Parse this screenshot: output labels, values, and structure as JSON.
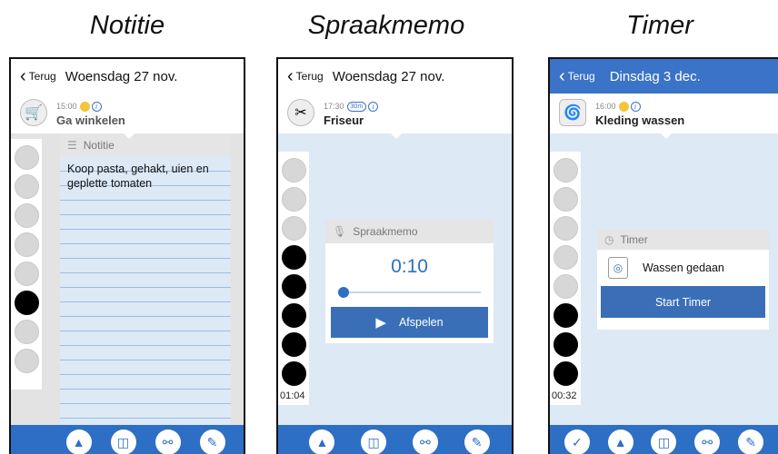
{
  "captions": {
    "left": "Notitie",
    "middle": "Spraakmemo",
    "right": "Timer"
  },
  "screens": {
    "notitie": {
      "back": "Terug",
      "date": "Woensdag 27 nov.",
      "task_time": "15:00",
      "task_name": "Ga winkelen",
      "panel_title": "Notitie",
      "note_text": "Koop pasta, gehakt, uien en geplette tomaten"
    },
    "spraakmemo": {
      "back": "Terug",
      "date": "Woensdag 27 nov.",
      "task_time": "17:30",
      "duration_badge": "30m",
      "task_name": "Friseur",
      "panel_title": "Spraakmemo",
      "memo_time": "0:10",
      "play_label": "Afspelen",
      "elapsed": "01:04"
    },
    "timer": {
      "back": "Terug",
      "date": "Dinsdag 3 dec.",
      "task_time": "16:00",
      "task_name": "Kleding wassen",
      "panel_title": "Timer",
      "timer_label": "Wassen gedaan",
      "start_label": "Start Timer",
      "elapsed": "00:32"
    }
  },
  "icons": {
    "back": "chevron-left-icon",
    "person": "person-icon",
    "trash": "trash-icon",
    "contacts": "contacts-icon",
    "edit": "edit-icon",
    "check": "check-icon",
    "play": "play-icon",
    "microphone": "microphone-icon",
    "clock": "clock-icon",
    "note": "note-icon",
    "washing_machine": "washing-machine-icon"
  },
  "colors": {
    "accent": "#2d6fc5",
    "panel_bg": "#dde9f5",
    "header_blue": "#3a73c8"
  }
}
